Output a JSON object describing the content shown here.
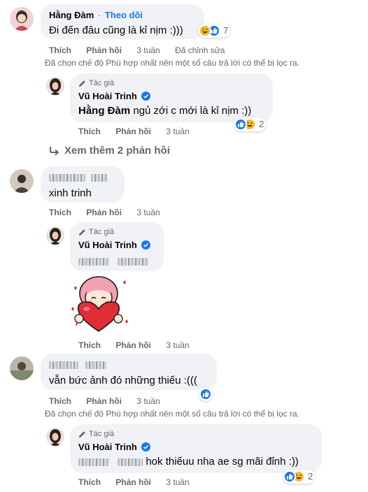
{
  "threads": {
    "c1": {
      "author": "Hằng Đàm",
      "follow": "Theo dõi",
      "text": "Đi đến đâu cũng là kỉ nịm :)))",
      "reaction_count": "7",
      "like": "Thích",
      "reply": "Phản hồi",
      "time": "3 tuần",
      "edited": "Đã chỉnh sửa",
      "filter_note": "Đã chọn chế độ Phù hợp nhất nên một số câu trả lời có thể bị lọc ra."
    },
    "r1": {
      "badge": "Tác giả",
      "author": "Vũ Hoài Trinh",
      "tag": "Hằng Đàm",
      "text": " ngủ zới c mới là kỉ nịm :))",
      "reaction_count": "2",
      "like": "Thích",
      "reply": "Phản hồi",
      "time": "3 tuần"
    },
    "more_replies": "Xem thêm 2 phản hồi",
    "c2": {
      "text": "xinh trinh",
      "like": "Thích",
      "reply": "Phản hồi",
      "time": "3 tuần"
    },
    "r2": {
      "badge": "Tác giả",
      "author": "Vũ Hoài Trinh",
      "like": "Thích",
      "reply": "Phản hồi",
      "time": "3 tuần"
    },
    "c3": {
      "text": "vẫn bức ảnh đó những thiếu :(((",
      "like": "Thích",
      "reply": "Phản hồi",
      "time": "3 tuần",
      "filter_note": "Đã chọn chế độ Phù hợp nhất nên một số câu trả lời có thể bị lọc ra."
    },
    "r3": {
      "badge": "Tác giả",
      "author": "Vũ Hoài Trinh",
      "text": " hok thiếuu nha ae sg mãi đỉnh :))",
      "reaction_count": "2",
      "like": "Thích",
      "reply": "Phản hồi",
      "time": "3 tuần"
    }
  },
  "colors": {
    "accent": "#1877f2",
    "bubble": "#f0f2f5",
    "meta": "#65676b",
    "like": "#1877f2",
    "haha": "#f7b928"
  },
  "icons": [
    "pencil-icon",
    "verified-badge-icon",
    "like-reaction-icon",
    "haha-reaction-icon",
    "reply-arrow-icon",
    "heart-sticker"
  ]
}
